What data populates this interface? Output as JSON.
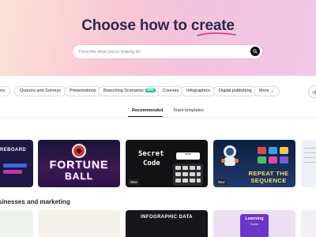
{
  "hero": {
    "title_main": "Choose how to ",
    "title_accent": "create",
    "search_placeholder": "Describe what you're looking for"
  },
  "chips": [
    {
      "label": "enges"
    },
    {
      "label": "Quizzes and Surveys"
    },
    {
      "label": "Presentations"
    },
    {
      "label": "Branching Scenarios",
      "badge": "NEW"
    },
    {
      "label": "Courses"
    },
    {
      "label": "Infographics"
    },
    {
      "label": "Digital publishing"
    },
    {
      "label": "More"
    }
  ],
  "tabs": [
    {
      "label": "Recommended",
      "active": true
    },
    {
      "label": "Team templates",
      "active": false
    }
  ],
  "cards": [
    {
      "text": "REBOARD"
    },
    {
      "line1": "FORTUNE",
      "line2": "BALL"
    },
    {
      "line1": "Secret",
      "line2": "Code",
      "display": "****"
    },
    {
      "line1": "REPEAT THE",
      "line2": "SEQUENCE"
    },
    {
      "text": ""
    }
  ],
  "new_badge": "New",
  "section": {
    "title": "sinesses and marketing"
  },
  "bottom_cards": [
    {
      "text": ""
    },
    {
      "text": ""
    },
    {
      "text": "INFOGRAPHIC DATA"
    },
    {
      "title": "Learning",
      "subtitle": "Mobile"
    },
    {
      "text": ""
    }
  ],
  "colors": {
    "accent_underline": "#d43b78",
    "chip_new_badge": "#13c2a3"
  }
}
